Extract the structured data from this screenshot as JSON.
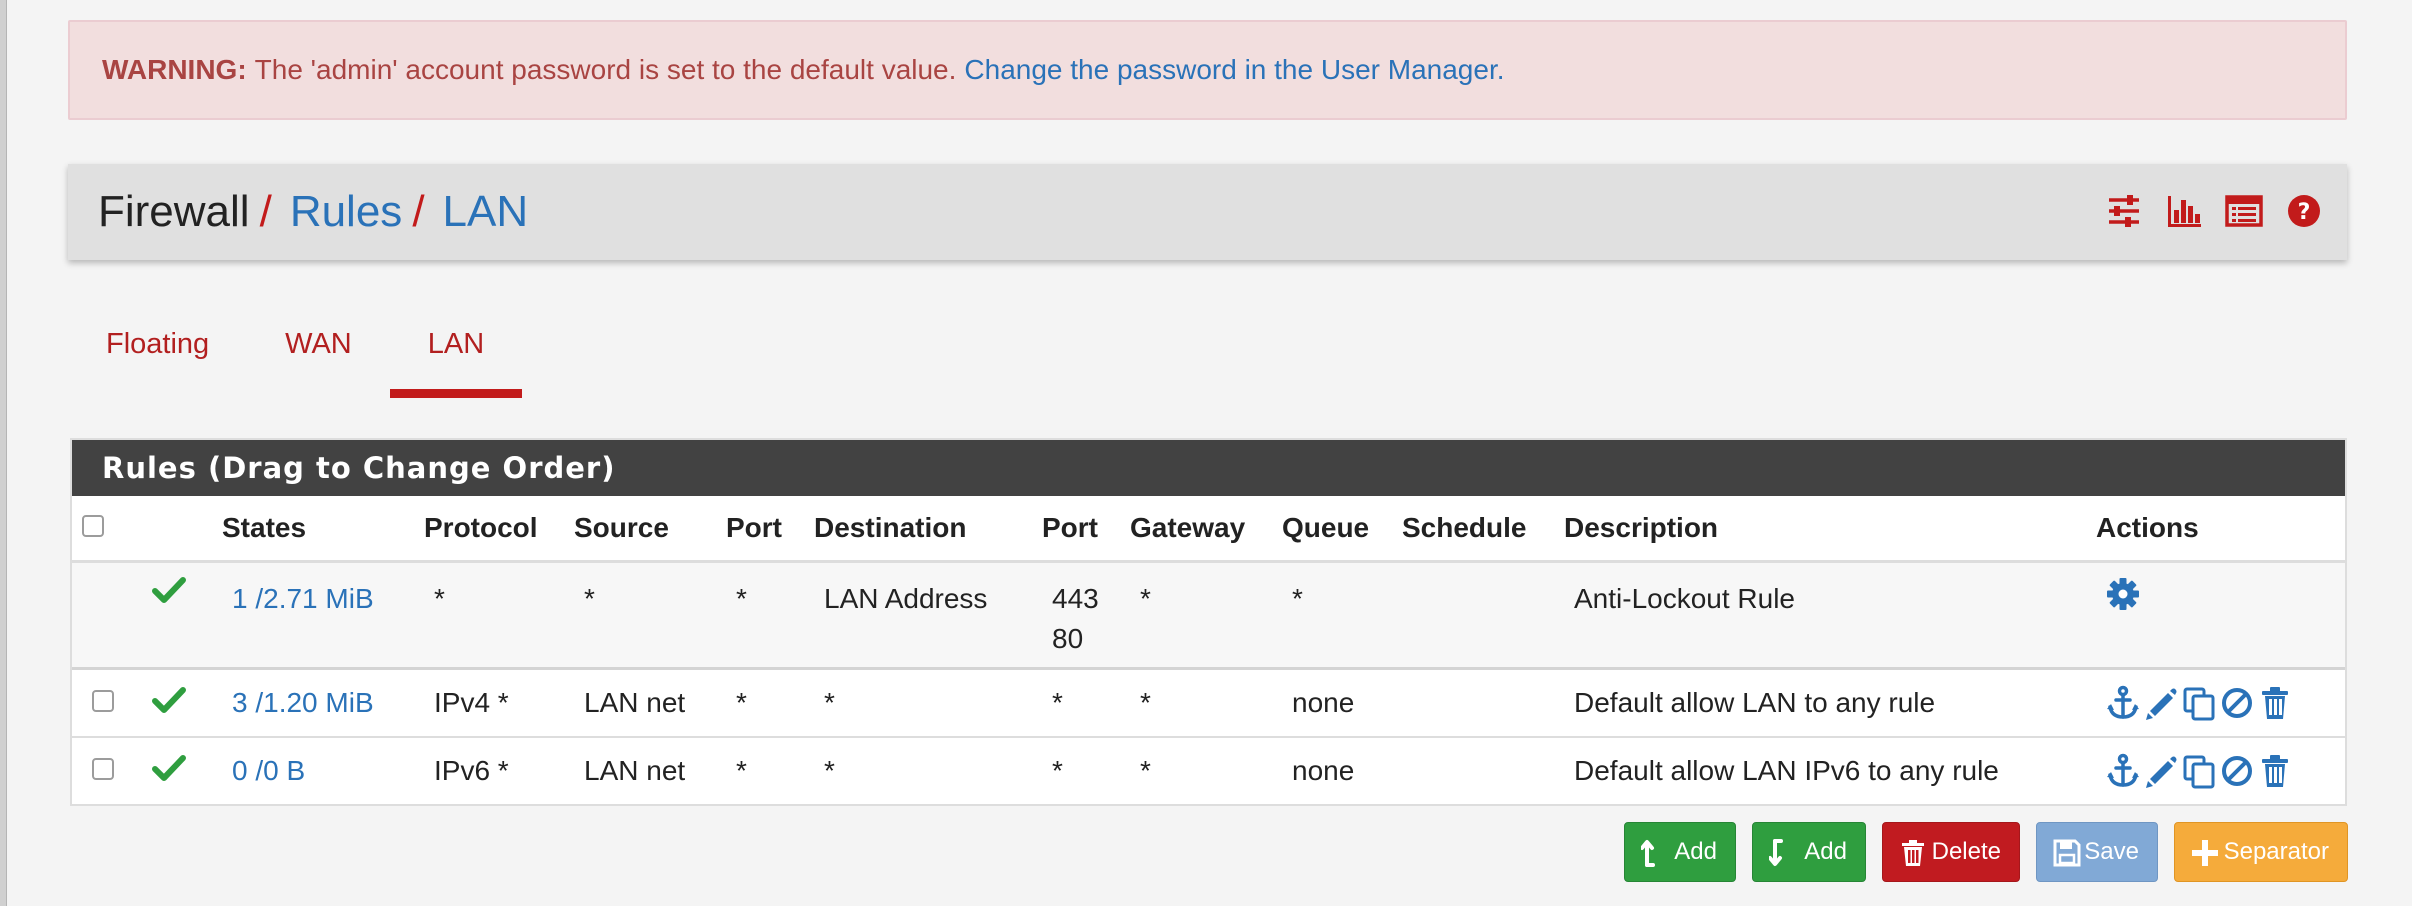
{
  "alert": {
    "label": "WARNING:",
    "message": "The 'admin' account password is set to the default value.",
    "link": "Change the password in the User Manager."
  },
  "breadcrumb": {
    "items": [
      "Firewall",
      "Rules",
      "LAN"
    ],
    "separator": "/",
    "icons": [
      "sliders-icon",
      "bar-chart-icon",
      "list-icon",
      "help-icon"
    ]
  },
  "tabs": [
    {
      "label": "Floating",
      "active": false
    },
    {
      "label": "WAN",
      "active": false
    },
    {
      "label": "LAN",
      "active": true
    }
  ],
  "panel": {
    "title": "Rules (Drag to Change Order)",
    "columns": [
      "States",
      "Protocol",
      "Source",
      "Port",
      "Destination",
      "Port",
      "Gateway",
      "Queue",
      "Schedule",
      "Description",
      "Actions"
    ],
    "rows": [
      {
        "checkbox": false,
        "enabled": true,
        "states": "1 /2.71 MiB",
        "protocol": "*",
        "source": "*",
        "source_port": "*",
        "destination": "LAN Address",
        "dest_port": [
          "443",
          "80"
        ],
        "gateway": "*",
        "queue": "*",
        "schedule": "",
        "description": "Anti-Lockout Rule",
        "actions": [
          "gear-icon"
        ]
      },
      {
        "checkbox": true,
        "enabled": true,
        "states": "3 /1.20 MiB",
        "protocol": "IPv4 *",
        "source": "LAN net",
        "source_port": "*",
        "destination": "*",
        "dest_port": [
          "*"
        ],
        "gateway": "*",
        "queue": "none",
        "schedule": "",
        "description": "Default allow LAN to any rule",
        "actions": [
          "anchor-icon",
          "pencil-icon",
          "copy-icon",
          "ban-icon",
          "trash-icon"
        ]
      },
      {
        "checkbox": true,
        "enabled": true,
        "states": "0 /0 B",
        "protocol": "IPv6 *",
        "source": "LAN net",
        "source_port": "*",
        "destination": "*",
        "dest_port": [
          "*"
        ],
        "gateway": "*",
        "queue": "none",
        "schedule": "",
        "description": "Default allow LAN IPv6 to any rule",
        "actions": [
          "anchor-icon",
          "pencil-icon",
          "copy-icon",
          "ban-icon",
          "trash-icon"
        ]
      }
    ]
  },
  "buttons": {
    "add_top": "Add",
    "add_bottom": "Add",
    "delete": "Delete",
    "save": "Save",
    "separator": "Separator"
  },
  "colors": {
    "accent_red": "#c21b1b",
    "link_blue": "#2a72b8",
    "success_green": "#2f9e3f",
    "alert_bg": "#f2dede",
    "heading_dark": "#424242",
    "warning_orange": "#f5ab3b"
  }
}
